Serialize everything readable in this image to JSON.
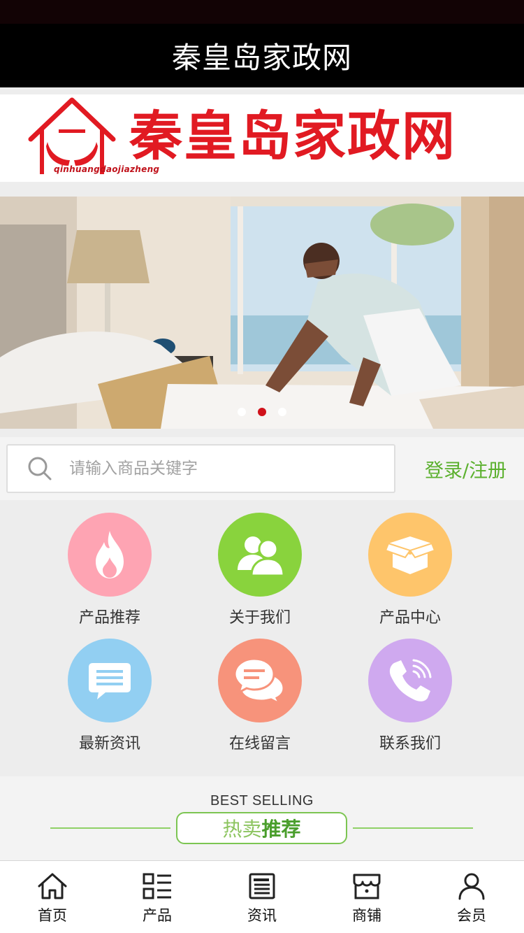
{
  "header": {
    "title": "秦皇岛家政网"
  },
  "logo": {
    "title": "秦皇岛家政网",
    "pinyin": "qinhuangdaojiazheng"
  },
  "carousel": {
    "slide_count": 3,
    "active_index": 1
  },
  "search": {
    "placeholder": "请输入商品关键字",
    "login_label": "登录/注册"
  },
  "nav": [
    {
      "label": "产品推荐",
      "icon": "flame-icon",
      "color": "#fea4b3"
    },
    {
      "label": "关于我们",
      "icon": "users-icon",
      "color": "#89d33d"
    },
    {
      "label": "产品中心",
      "icon": "box-icon",
      "color": "#fec56b"
    },
    {
      "label": "最新资讯",
      "icon": "message-icon",
      "color": "#92cff2"
    },
    {
      "label": "在线留言",
      "icon": "chat-icon",
      "color": "#f7937b"
    },
    {
      "label": "联系我们",
      "icon": "phone-icon",
      "color": "#cfa9ef"
    }
  ],
  "best_selling": {
    "heading": "BEST SELLING",
    "label_a": "热卖",
    "label_b": "推荐"
  },
  "tabbar": [
    {
      "label": "首页",
      "icon": "home-icon"
    },
    {
      "label": "产品",
      "icon": "grid-list-icon"
    },
    {
      "label": "资讯",
      "icon": "news-icon"
    },
    {
      "label": "商铺",
      "icon": "shop-icon"
    },
    {
      "label": "会员",
      "icon": "user-icon"
    }
  ]
}
